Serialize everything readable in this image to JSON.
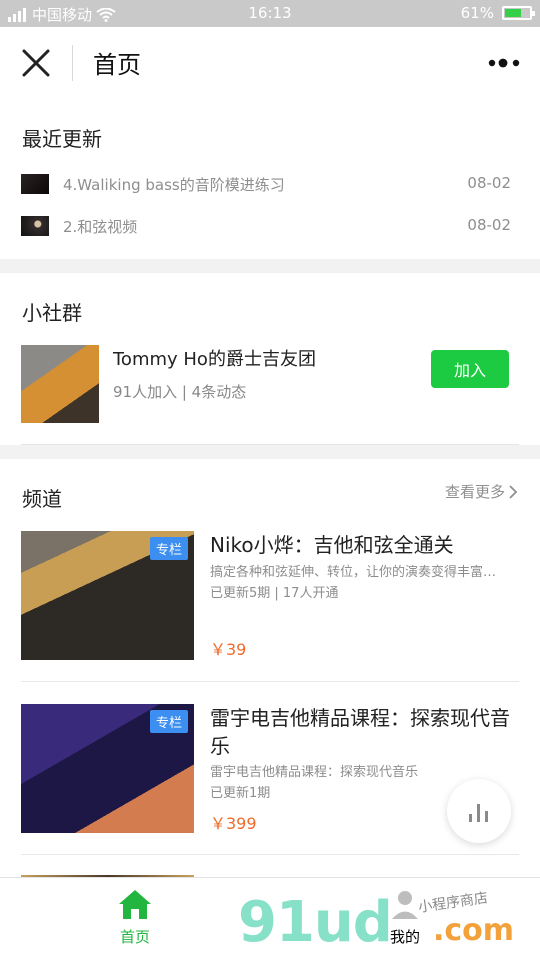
{
  "status": {
    "carrier": "中国移动",
    "time": "16:13",
    "battery": "61%",
    "battery_level": 0.61
  },
  "nav": {
    "title": "首页"
  },
  "recent": {
    "title": "最近更新",
    "items": [
      {
        "label": "4.Waliking bass的音阶模进练习",
        "date": "08-02"
      },
      {
        "label": "2.和弦视频",
        "date": "08-02"
      }
    ]
  },
  "community": {
    "title": "小社群",
    "group": {
      "name": "Tommy Ho的爵士吉友团",
      "meta": "91人加入 | 4条动态",
      "button": "加入"
    }
  },
  "channels": {
    "title": "频道",
    "more": "查看更多",
    "items": [
      {
        "tag": "专栏",
        "title": "Niko小烨：吉他和弦全通关",
        "desc": "搞定各种和弦延伸、转位，让你的演奏变得丰富…",
        "update": "已更新5期 | 17人开通",
        "price": "￥39"
      },
      {
        "tag": "专栏",
        "title": "雷宇电吉他精品课程：探索现代音乐",
        "desc": "雷宇电吉他精品课程：探索现代音乐",
        "update": "已更新1期",
        "price": "￥399"
      }
    ]
  },
  "tabbar": {
    "home": "首页",
    "mine": "我的"
  },
  "watermark": {
    "main": "91ud",
    "suffix": ".com",
    "small": "小程序商店"
  },
  "colors": {
    "primary": "#1ccb41",
    "price": "#f06b2a",
    "tag": "#3c8ff1"
  }
}
